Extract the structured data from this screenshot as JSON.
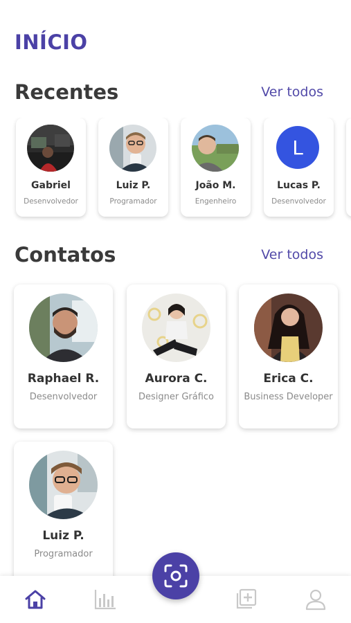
{
  "page": {
    "title": "INÍCIO"
  },
  "recentes": {
    "title": "Recentes",
    "see_all": "Ver todos",
    "items": [
      {
        "name": "Gabriel",
        "role": "Desenvolvedor",
        "avatar": "photo-gabriel"
      },
      {
        "name": "Luiz P.",
        "role": "Programador",
        "avatar": "photo-luiz"
      },
      {
        "name": "João M.",
        "role": "Engenheiro",
        "avatar": "photo-joao"
      },
      {
        "name": "Lucas P.",
        "role": "Desenvolvedor",
        "avatar": "initial",
        "initial": "L"
      }
    ]
  },
  "contatos": {
    "title": "Contatos",
    "see_all": "Ver todos",
    "items": [
      {
        "name": "Raphael R.",
        "role": "Desenvolvedor"
      },
      {
        "name": "Aurora C.",
        "role": "Designer Gráfico"
      },
      {
        "name": "Erica C.",
        "role": "Business Developer"
      },
      {
        "name": "Luiz P.",
        "role": "Programador"
      }
    ]
  },
  "nav": {
    "items": [
      "home-icon",
      "bar-chart-icon",
      "add-card-icon",
      "profile-icon"
    ],
    "fab_icon": "scan-face-icon",
    "active_color": "#4b41a6",
    "inactive_color": "#c8c8c8"
  },
  "colors": {
    "accent": "#4b41a6",
    "initial_avatar": "#3454e0"
  }
}
